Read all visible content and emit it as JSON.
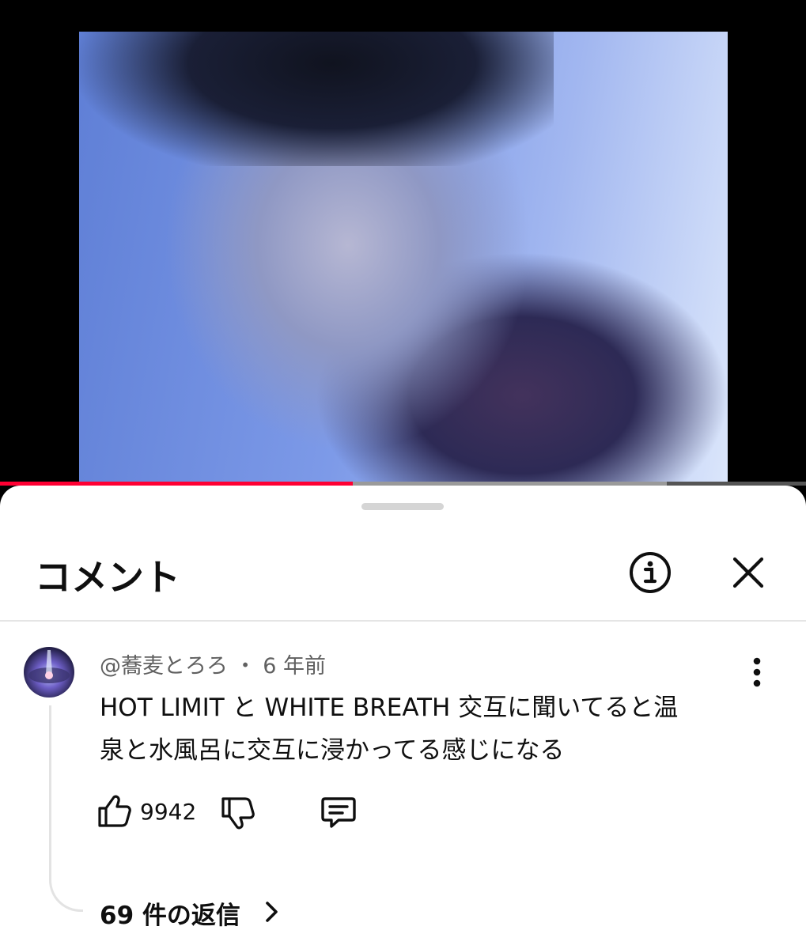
{
  "video": {
    "progress_played": 0.438,
    "progress_buffered_end": 0.827
  },
  "sheet": {
    "title": "コメント",
    "info_icon": "info-circle-icon",
    "close_icon": "close-icon"
  },
  "comment": {
    "author": "@蕎麦とろろ",
    "separator": "・",
    "time": "6 年前",
    "text_line1": "HOT LIMIT と WHITE BREATH 交互に聞いてると温",
    "text_line2": "泉と水風呂に交互に浸かってる感じになる",
    "like_count": "9942",
    "replies_label": "69 件の返信"
  },
  "colors": {
    "progress_played": "#ff0033",
    "progress_buffer": "#9a9a9a",
    "text_primary": "#0f0f0f",
    "text_secondary": "#606060"
  }
}
